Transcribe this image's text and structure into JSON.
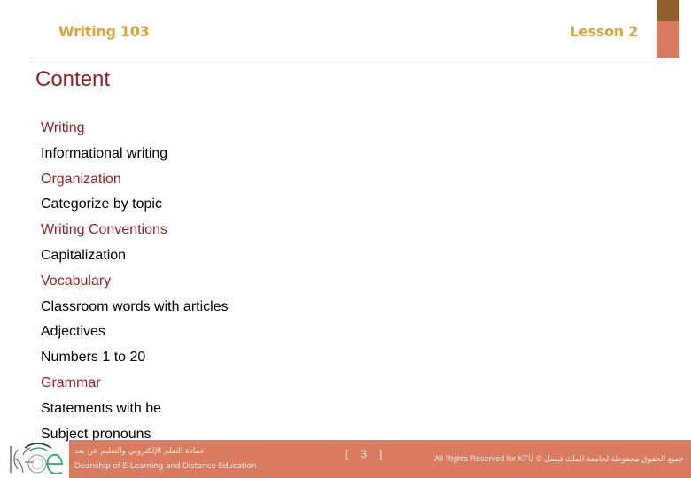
{
  "header": {
    "course": "Writing 103",
    "lesson": "Lesson 2"
  },
  "colors": {
    "header_text": "#d9a441",
    "heading_red": "#9b1c1c",
    "accent_dark": "#8f5f2f",
    "accent_salmon": "#d97b5e",
    "rule": "#7a9176"
  },
  "slide": {
    "title": "Content",
    "items": [
      {
        "text": "Writing",
        "type": "heading"
      },
      {
        "text": "Informational writing",
        "type": "subitem"
      },
      {
        "text": "Organization",
        "type": "heading"
      },
      {
        "text": "Categorize by topic",
        "type": "subitem"
      },
      {
        "text": "Writing Conventions",
        "type": "heading"
      },
      {
        "text": "Capitalization",
        "type": "subitem"
      },
      {
        "text": "Vocabulary",
        "type": "heading"
      },
      {
        "text": "Classroom words with articles",
        "type": "subitem"
      },
      {
        "text": "Adjectives",
        "type": "subitem"
      },
      {
        "text": "Numbers 1 to 20",
        "type": "subitem"
      },
      {
        "text": "Grammar",
        "type": "heading"
      },
      {
        "text": "Statements with be",
        "type": "subitem"
      },
      {
        "text": "Subject pronouns",
        "type": "subitem"
      }
    ]
  },
  "footer": {
    "logo": "kfu-elearning-logo",
    "arabic_deanship": "عمادة التعلم الإلكتروني والتعليم عن بعد",
    "deanship": "Deanship of E-Learning and Distance Education",
    "page_open": "[",
    "page_number": "3",
    "page_close": "]",
    "copyright": "All Rights Reserved for KFU © جميع الحقوق محفوظة لجامعة الملك فيصل"
  }
}
